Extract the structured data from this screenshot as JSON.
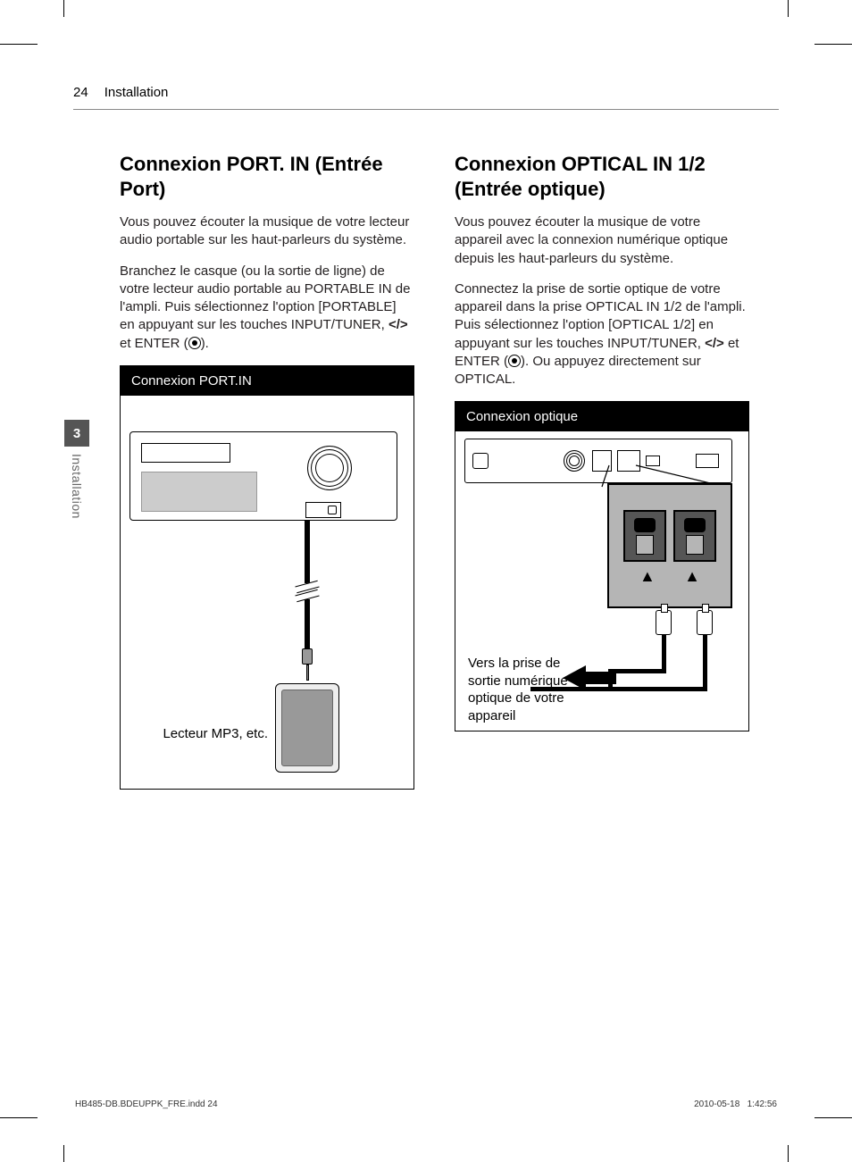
{
  "page": {
    "number": "24",
    "section": "Installation"
  },
  "sidetab": {
    "num": "3",
    "label": "Installation"
  },
  "left": {
    "heading": "Connexion PORT. IN (Entrée Port)",
    "p1": "Vous pouvez écouter la musique de votre lecteur audio portable sur les haut-parleurs du système.",
    "p2a": "Branchez le casque (ou la sortie de ligne) de votre lecteur audio portable au PORTABLE IN de l'ampli. Puis sélectionnez l'option [PORTABLE] en appuyant sur les touches INPUT/TUNER, ",
    "btn_nav": "</>",
    "p2b": " et ENTER (",
    "p2c": ").",
    "diagram_title": "Connexion PORT.IN",
    "mp3_label": "Lecteur MP3, etc."
  },
  "right": {
    "heading": "Connexion OPTICAL IN 1/2 (Entrée optique)",
    "p1": "Vous pouvez écouter la musique de votre appareil avec la connexion numérique optique depuis les haut-parleurs du système.",
    "p2a": "Connectez la prise de sortie optique de votre appareil dans la prise OPTICAL IN 1/2 de l'ampli. Puis sélectionnez l'option [OPTICAL 1/2] en appuyant sur les touches INPUT/TUNER, ",
    "btn_nav": "</>",
    "p2b": " et ENTER (",
    "p2c": "). Ou appuyez directement sur OPTICAL.",
    "diagram_title": "Connexion optique",
    "caption": "Vers la prise de sortie numérique optique de votre appareil"
  },
  "footer": {
    "file": "HB485-DB.BDEUPPK_FRE.indd   24",
    "date": "2010-05-18",
    "time": "1:42:56"
  }
}
